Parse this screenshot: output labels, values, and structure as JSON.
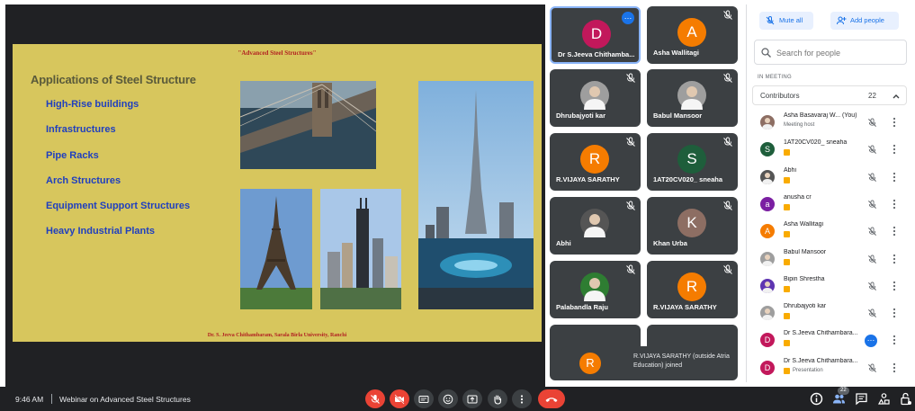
{
  "meeting": {
    "time": "9:46 AM",
    "title": "Webinar on Advanced Steel Structures"
  },
  "slide": {
    "header": "\"Advanced Steel Structures\"",
    "title": "Applications of Steel Structure",
    "bullets": [
      "High-Rise buildings",
      "Infrastructures",
      "Pipe Racks",
      "Arch Structures",
      "Equipment Support Structures",
      "Heavy Industrial Plants"
    ],
    "footer": "Dr. S. Jeeva Chithambaram, Sarala Birla University, Ranchi"
  },
  "tiles": [
    {
      "name": "Dr S.Jeeva Chithamba...",
      "initial": "D",
      "color": "#c2185b",
      "kind": "letter",
      "active": true
    },
    {
      "name": "Asha Wallitagi",
      "initial": "A",
      "color": "#f57c00",
      "kind": "letter"
    },
    {
      "name": "Dhrubajyoti kar",
      "initial": "",
      "color": "#9e9e9e",
      "kind": "photo"
    },
    {
      "name": "Babul Mansoor",
      "initial": "",
      "color": "#9e9e9e",
      "kind": "photo"
    },
    {
      "name": "R.VIJAYA SARATHY",
      "initial": "R",
      "color": "#f57c00",
      "kind": "letter"
    },
    {
      "name": "1AT20CV020_ sneaha",
      "initial": "S",
      "color": "#1e5e3b",
      "kind": "letter"
    },
    {
      "name": "Abhi",
      "initial": "",
      "color": "#555555",
      "kind": "photo"
    },
    {
      "name": "Khan Urba",
      "initial": "K",
      "color": "#8d6e63",
      "kind": "letter"
    },
    {
      "name": "Palabandla Raju",
      "initial": "",
      "color": "#2e7d32",
      "kind": "photo"
    },
    {
      "name": "R.VIJAYA SARATHY",
      "initial": "R",
      "color": "#f57c00",
      "kind": "letter"
    }
  ],
  "toast": {
    "initial": "R",
    "text": "R.VIJAYA SARATHY (outside Atria Education) joined"
  },
  "panel": {
    "mute_all_label": "Mute all",
    "add_people_label": "Add people",
    "search_placeholder": "Search for people",
    "section_label": "IN MEETING",
    "group_label": "Contributors",
    "group_count": "22",
    "people": [
      {
        "name": "Asha Basavaraj W...  (You)",
        "sub": "Meeting host",
        "initial": "",
        "color": "#8d6e63",
        "badge": false
      },
      {
        "name": "1AT20CV020_ sneaha",
        "sub": "",
        "initial": "S",
        "color": "#1e5e3b",
        "badge": true
      },
      {
        "name": "Abhi",
        "sub": "",
        "initial": "",
        "color": "#555555",
        "badge": true
      },
      {
        "name": "anusha cr",
        "sub": "",
        "initial": "a",
        "color": "#7b1fa2",
        "badge": true
      },
      {
        "name": "Asha Wallitagi",
        "sub": "",
        "initial": "A",
        "color": "#f57c00",
        "badge": true
      },
      {
        "name": "Babul Mansoor",
        "sub": "",
        "initial": "",
        "color": "#9e9e9e",
        "badge": true
      },
      {
        "name": "Bipin Shrestha",
        "sub": "",
        "initial": "",
        "color": "#5e35b1",
        "badge": true
      },
      {
        "name": "Dhrubajyoti kar",
        "sub": "",
        "initial": "",
        "color": "#9e9e9e",
        "badge": true
      },
      {
        "name": "Dr S.Jeeva Chithambara...",
        "sub": "",
        "initial": "D",
        "color": "#c2185b",
        "badge": true
      },
      {
        "name": "Dr S.Jeeva Chithambara...",
        "sub": "Presentation",
        "initial": "D",
        "color": "#c2185b",
        "badge": true
      }
    ]
  },
  "controls": {
    "people_count": "22",
    "icons": [
      "mic-off-icon",
      "camera-off-icon",
      "captions-icon",
      "emoji-icon",
      "present-icon",
      "raise-hand-icon",
      "more-options-icon",
      "leave-call-icon"
    ],
    "right_icons": [
      "info-icon",
      "people-icon",
      "chat-icon",
      "activities-icon",
      "host-controls-icon"
    ]
  }
}
